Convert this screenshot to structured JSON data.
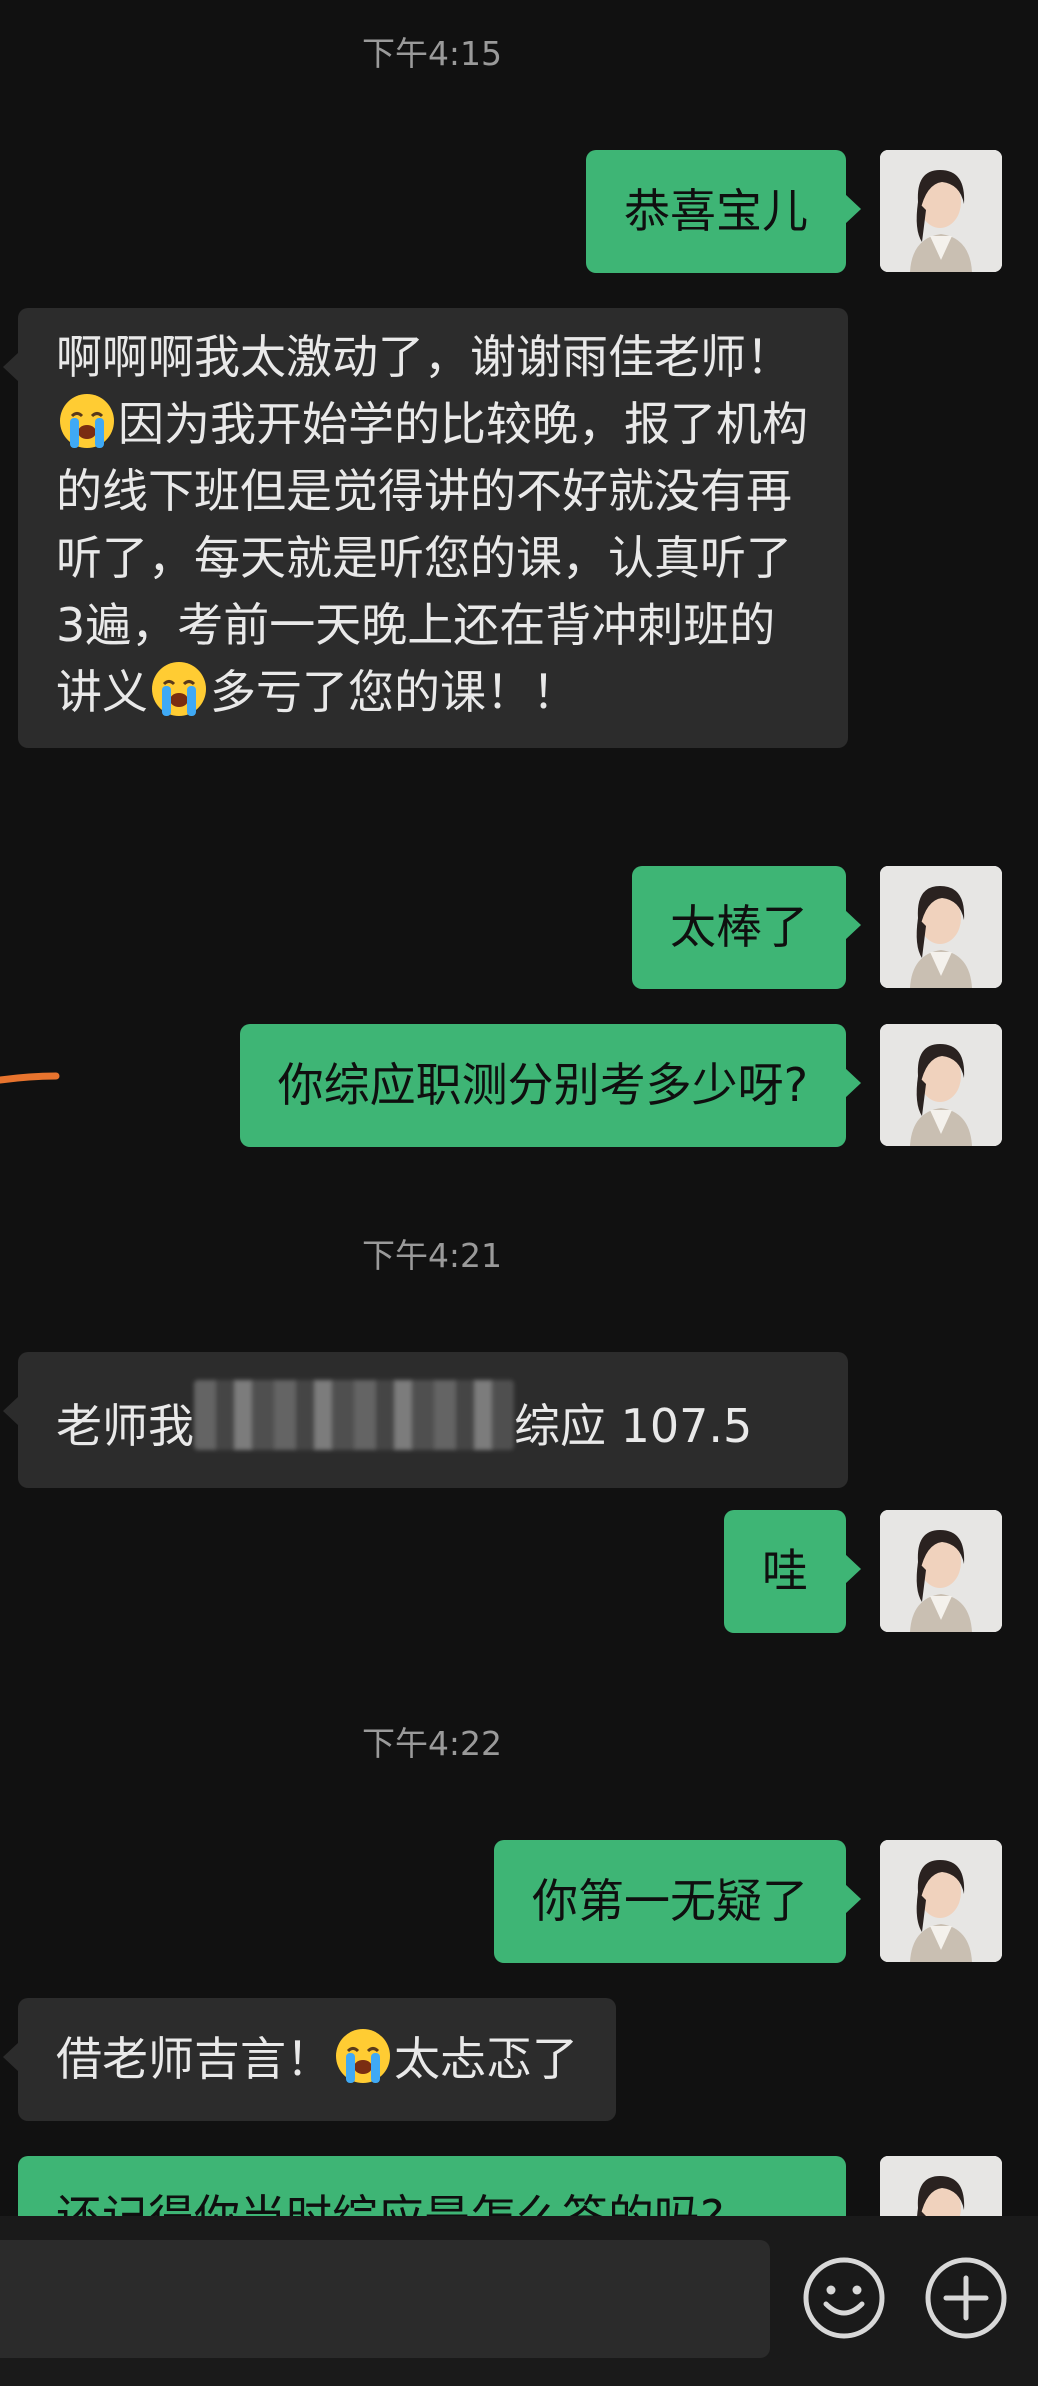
{
  "chat": {
    "timestamps": [
      "下午4:15",
      "下午4:21",
      "下午4:22"
    ],
    "messages": [
      {
        "from": "me",
        "text": "恭喜宝儿"
      },
      {
        "from": "other",
        "parts": [
          "啊啊啊我太激动了，谢谢雨佳老师！",
          "因为我开始学的比较晚，报了机构的线下班但是觉得讲的不好就没有再听了，每天就是听您的课，认真听了3遍，考前一天晚上还在背冲刺班的讲义",
          "多亏了您的课！！"
        ],
        "emoji": "loudly-crying-face"
      },
      {
        "from": "me",
        "text": "太棒了"
      },
      {
        "from": "me",
        "text": "你综应职测分别考多少呀?"
      },
      {
        "from": "other",
        "parts": [
          "老师我",
          "综应 107.5"
        ],
        "redacted": true
      },
      {
        "from": "me",
        "text": "哇"
      },
      {
        "from": "me",
        "text": "你第一无疑了"
      },
      {
        "from": "other",
        "parts": [
          "借老师吉言！",
          "太忐忑了"
        ],
        "emoji": "loudly-crying-face"
      },
      {
        "from": "me",
        "text": "还记得你当时综应是怎么答的吗?"
      }
    ]
  },
  "composer": {
    "input_value": "",
    "emoji_icon": "smiley-face-icon",
    "plus_icon": "plus-circle-icon"
  },
  "colors": {
    "background": "#111111",
    "sent_bubble": "#3eb575",
    "received_bubble": "#2c2c2c",
    "timestamp": "#9a9a9a"
  }
}
